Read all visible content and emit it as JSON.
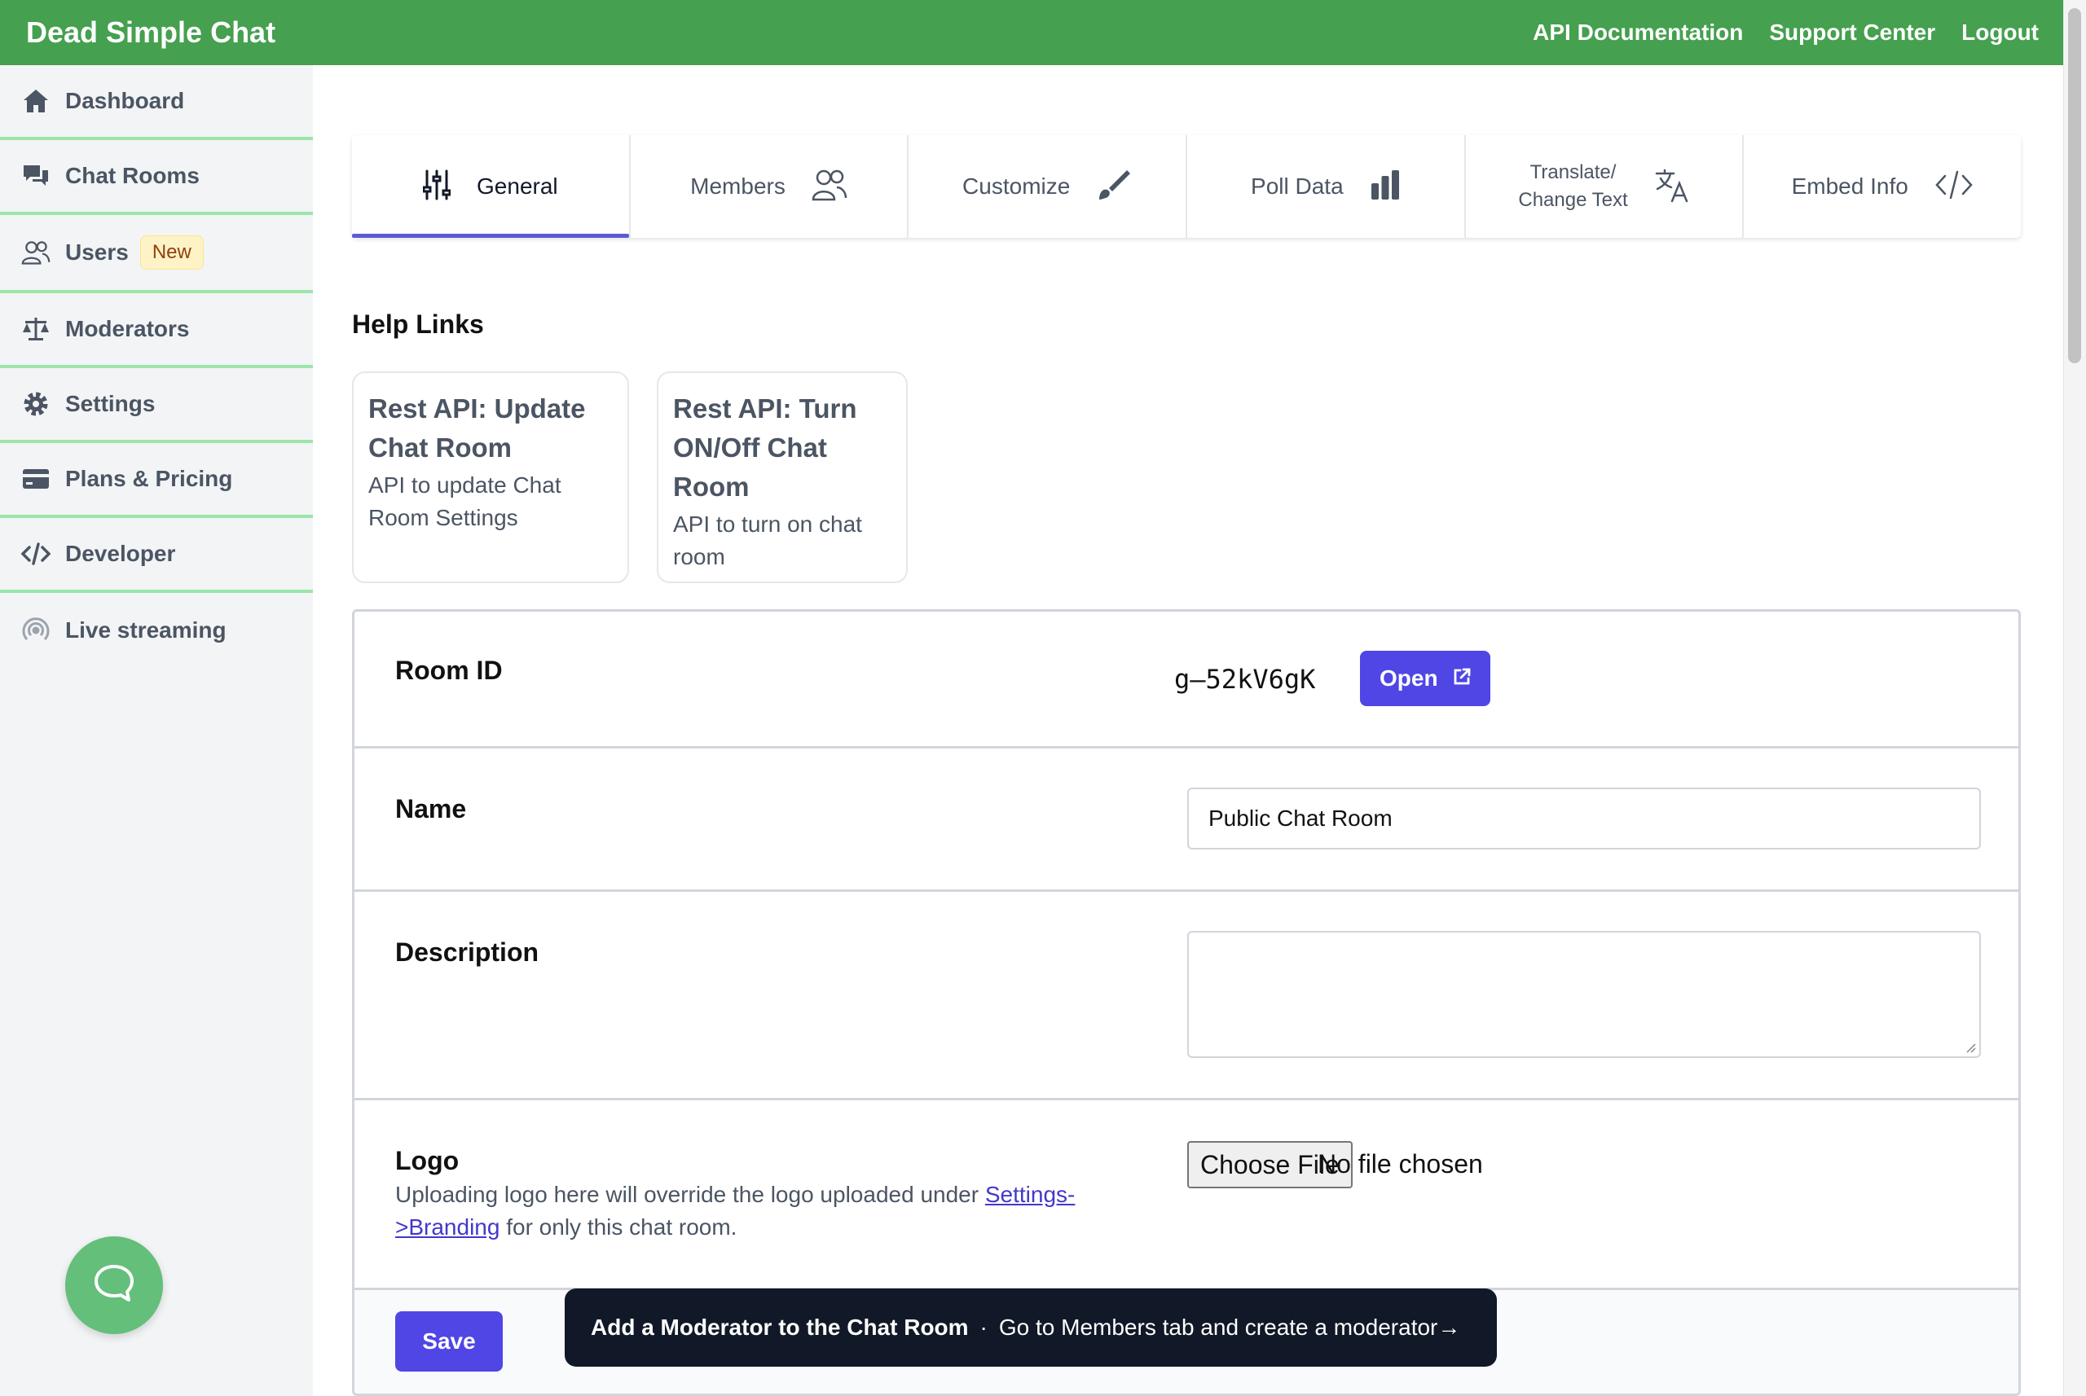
{
  "header": {
    "brand": "Dead Simple Chat",
    "links": [
      "API Documentation",
      "Support Center",
      "Logout"
    ]
  },
  "sidebar": {
    "items": [
      {
        "label": "Dashboard",
        "icon": "home-icon"
      },
      {
        "label": "Chat Rooms",
        "icon": "chat-bubbles-icon"
      },
      {
        "label": "Users",
        "icon": "users-icon",
        "badge": "New"
      },
      {
        "label": "Moderators",
        "icon": "scale-icon"
      },
      {
        "label": "Settings",
        "icon": "gear-icon"
      },
      {
        "label": "Plans & Pricing",
        "icon": "credit-card-icon"
      },
      {
        "label": "Developer",
        "icon": "code-icon"
      },
      {
        "label": "Live streaming",
        "icon": "broadcast-icon"
      }
    ]
  },
  "tabs": [
    {
      "label": "General",
      "icon": "sliders-icon",
      "active": true
    },
    {
      "label": "Members",
      "icon": "users-icon"
    },
    {
      "label": "Customize",
      "icon": "paintbrush-icon"
    },
    {
      "label": "Poll Data",
      "icon": "bar-chart-icon"
    },
    {
      "label_line1": "Translate/",
      "label_line2": "Change Text",
      "icon": "translate-icon"
    },
    {
      "label": "Embed Info",
      "icon": "code-icon"
    }
  ],
  "help": {
    "title": "Help Links",
    "cards": [
      {
        "title_line1": "Rest API: Update",
        "title_line2": "Chat Room",
        "desc_line1": "API to update Chat",
        "desc_line2": "Room Settings"
      },
      {
        "title_line1": "Rest API: Turn",
        "title_line2": "ON/Off Chat",
        "title_line3": "Room",
        "desc_line1": "API to turn on chat",
        "desc_line2": "room"
      }
    ]
  },
  "form": {
    "room_id_label": "Room ID",
    "room_id_value": "g–52kV6gK",
    "open_label": "Open",
    "name_label": "Name",
    "name_value": "Public Chat Room",
    "description_label": "Description",
    "description_value": "",
    "logo_label": "Logo",
    "logo_desc_before": "Uploading logo here will override the logo uploaded under ",
    "logo_desc_link_line1": "Settings-",
    "logo_desc_link_line2": ">Branding",
    "logo_desc_after": " for only this chat room.",
    "choose_file_label": "Choose File",
    "no_file_label": "No file chosen",
    "save_label": "Save"
  },
  "toast": {
    "title": "Add a Moderator to the Chat Room",
    "separator": "·",
    "message": "Go to Members tab and create a moderator→"
  },
  "colors": {
    "header_green": "#45a04f",
    "accent_indigo": "#4f46e5",
    "sidebar_divider": "#9be6a8",
    "chat_bubble": "#63bf7a"
  }
}
